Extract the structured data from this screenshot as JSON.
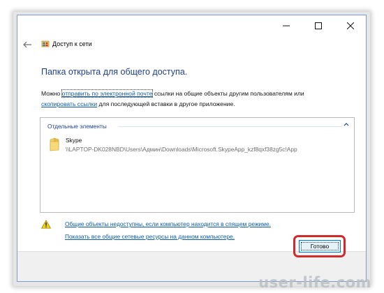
{
  "titlebar": {
    "icons": [
      "minimize-icon",
      "maximize-icon",
      "close-icon"
    ]
  },
  "wizard": {
    "back_icon": "back-arrow-icon",
    "app_icon": "network-sharing-icon",
    "title": "Доступ к сети"
  },
  "main": {
    "heading": "Папка открыта для общего доступа.",
    "desc_prefix": "Можно ",
    "email_link": "отправить по электронной почте",
    "desc_middle": " ссылки на общие объекты другим пользователям или",
    "copy_link": "скопировать ссылки",
    "desc_suffix": " для последующей вставки в другое приложение."
  },
  "list": {
    "group_label": "Отдельные элементы",
    "group_icon": "chevron-up-icon",
    "items": [
      {
        "icon": "folder-icon",
        "name": "Skype",
        "path": "\\\\LAPTOP-DK028NBD\\Users\\Админ\\Downloads\\Microsoft.SkypeApp_kzf8qxf38zg5c!App"
      }
    ]
  },
  "warning": {
    "icon": "warning-icon",
    "text": "Общие объекты недоступны, если компьютер находится в спящем режиме."
  },
  "show_link": "Показать все общие сетевые ресурсы на данном компьютере.",
  "footer": {
    "done_label": "Готово",
    "highlight_color": "#d22a2a"
  },
  "watermark": "user-life.com",
  "colors": {
    "heading": "#1e3f8f",
    "link": "#0c5aa6",
    "button_border": "#0078d7",
    "button_fill": "#e5f1fb"
  }
}
